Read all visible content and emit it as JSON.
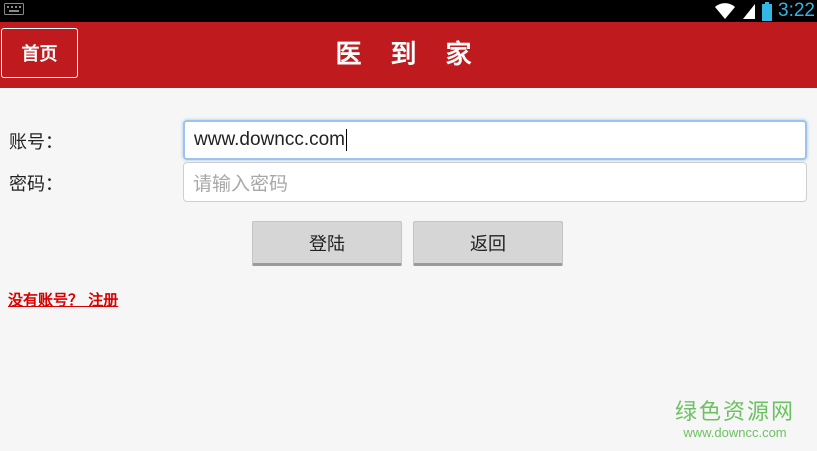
{
  "status_bar": {
    "time": "3:22",
    "icons": [
      "keyboard-icon",
      "wifi-icon",
      "signal-icon",
      "battery-icon"
    ],
    "accent_color": "#33b5e5"
  },
  "header": {
    "home_label": "首页",
    "title": "医 到 家",
    "background_color": "#bf1b1f"
  },
  "form": {
    "account_label": "账号：",
    "account_value": "www.downcc.com",
    "password_label": "密码：",
    "password_placeholder": "请输入密码"
  },
  "actions": {
    "login_label": "登陆",
    "back_label": "返回"
  },
  "register": {
    "link_text": "没有账号？ 注册",
    "color": "#d90000"
  },
  "watermark": {
    "title": "绿色资源网",
    "url": "www.downcc.com"
  }
}
